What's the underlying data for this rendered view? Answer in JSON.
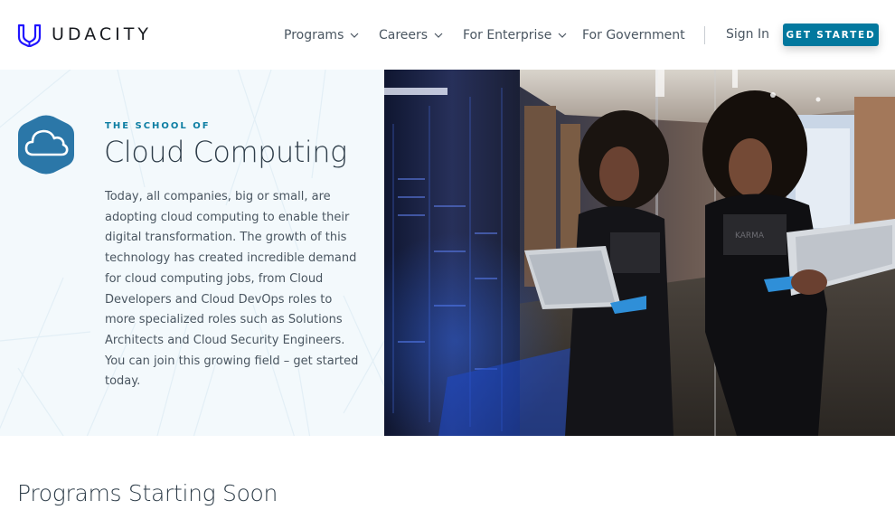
{
  "header": {
    "brand": "UDACITY",
    "brand_color": "#2015ff",
    "nav": [
      {
        "label": "Programs",
        "has_dropdown": true
      },
      {
        "label": "Careers",
        "has_dropdown": true
      },
      {
        "label": "For Enterprise",
        "has_dropdown": true
      },
      {
        "label": "For Government",
        "has_dropdown": false
      }
    ],
    "sign_in": "Sign In",
    "cta": "GET STARTED",
    "cta_color": "#02789e"
  },
  "hero": {
    "icon": "cloud-icon",
    "eyebrow": "THE SCHOOL OF",
    "title": "Cloud Computing",
    "description": "Today, all companies, big or small, are adopting cloud computing to enable their digital transformation. The growth of this technology has created incredible demand for cloud computing jobs, from Cloud Developers and Cloud DevOps roles to more specialized roles such as Solutions Architects and Cloud Security Engineers. You can join this growing field – get started today.",
    "image_alt": "Woman holding a tablet leaning against a glass wall in a server room",
    "image_shirt_text": "KARMA"
  },
  "programs": {
    "heading": "Programs Starting Soon"
  }
}
